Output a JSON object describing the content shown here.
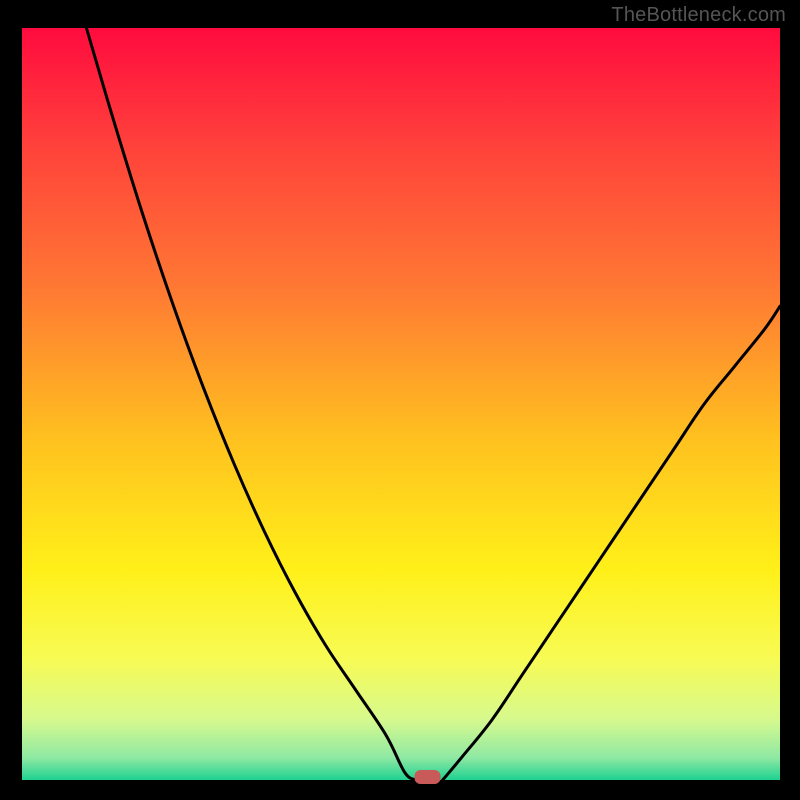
{
  "watermark": "TheBottleneck.com",
  "marker": {
    "x": 0.535,
    "y_pct": 0
  },
  "chart_data": {
    "type": "line",
    "title": "",
    "xlabel": "",
    "ylabel": "",
    "xlim": [
      0,
      1
    ],
    "ylim": [
      0,
      100
    ],
    "curves": [
      {
        "name": "left",
        "x": [
          0.085,
          0.12,
          0.16,
          0.2,
          0.24,
          0.28,
          0.32,
          0.36,
          0.4,
          0.44,
          0.48,
          0.505,
          0.52
        ],
        "pct": [
          100,
          88,
          75,
          63,
          52,
          42,
          33,
          25,
          18,
          12,
          6,
          1,
          0
        ]
      },
      {
        "name": "right",
        "x": [
          0.555,
          0.58,
          0.62,
          0.66,
          0.7,
          0.74,
          0.78,
          0.82,
          0.86,
          0.9,
          0.94,
          0.98,
          1.0
        ],
        "pct": [
          0,
          3,
          8,
          14,
          20,
          26,
          32,
          38,
          44,
          50,
          55,
          60,
          63
        ]
      }
    ],
    "gradient": {
      "stops": [
        {
          "offset": 0.0,
          "color": "#ff0b3e"
        },
        {
          "offset": 0.15,
          "color": "#ff3f3b"
        },
        {
          "offset": 0.35,
          "color": "#ff7a33"
        },
        {
          "offset": 0.55,
          "color": "#ffc21f"
        },
        {
          "offset": 0.72,
          "color": "#fff019"
        },
        {
          "offset": 0.84,
          "color": "#f7fb55"
        },
        {
          "offset": 0.92,
          "color": "#d6f98e"
        },
        {
          "offset": 0.97,
          "color": "#8fe9a3"
        },
        {
          "offset": 1.0,
          "color": "#1fd191"
        }
      ]
    },
    "frame_color": "#000000",
    "marker_color": "#c95a5a"
  }
}
